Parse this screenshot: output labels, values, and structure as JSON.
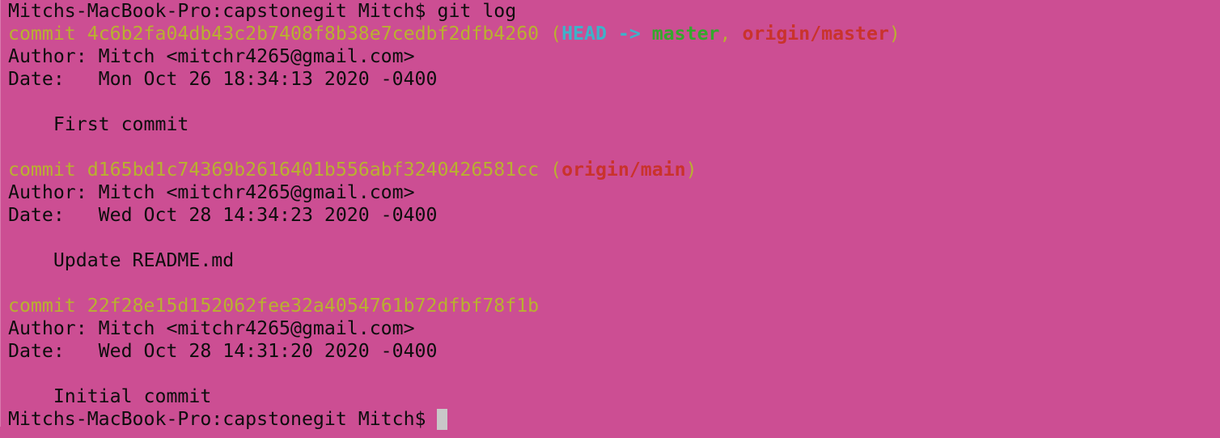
{
  "terminal": {
    "background_color": "#cc4e93",
    "prompt": "Mitchs-MacBook-Pro:capstonegit Mitch$ ",
    "command": "git log",
    "commits": [
      {
        "keyword": "commit ",
        "hash": "4c6b2fa04db43c2b7408f8b38e7cedbf2dfb4260",
        "refs": {
          "open": " (",
          "head": "HEAD -> ",
          "branch": "master",
          "sep": ", ",
          "remote": "origin/master",
          "close": ")"
        },
        "author": "Author: Mitch <mitchr4265@gmail.com>",
        "date": "Date:   Mon Oct 26 18:34:13 2020 -0400",
        "message": "    First commit"
      },
      {
        "keyword": "commit ",
        "hash": "d165bd1c74369b2616401b556abf3240426581cc",
        "refs": {
          "open": " (",
          "remote": "origin/main",
          "close": ")"
        },
        "author": "Author: Mitch <mitchr4265@gmail.com>",
        "date": "Date:   Wed Oct 28 14:34:23 2020 -0400",
        "message": "    Update README.md"
      },
      {
        "keyword": "commit ",
        "hash": "22f28e15d152062fee32a4054761b72dfbf78f1b",
        "author": "Author: Mitch <mitchr4265@gmail.com>",
        "date": "Date:   Wed Oct 28 14:31:20 2020 -0400",
        "message": "    Initial commit"
      }
    ],
    "final_prompt": "Mitchs-MacBook-Pro:capstonegit Mitch$ ",
    "colors": {
      "text": "#0d0d0d",
      "commit_hash": "#b9b12f",
      "head_ref": "#3fb1c9",
      "local_branch": "#34a82d",
      "remote_branch": "#c9332c",
      "cursor": "#c8c8c8"
    }
  }
}
